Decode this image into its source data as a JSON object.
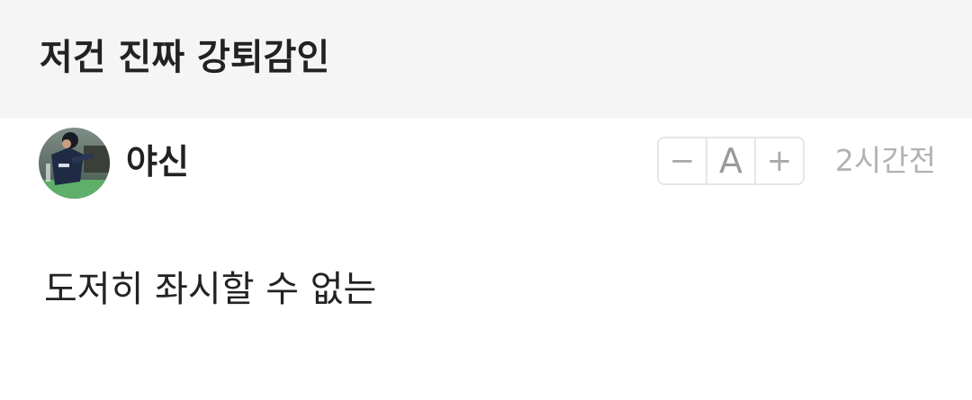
{
  "post": {
    "title": "저건 진짜 강퇴감인"
  },
  "author": {
    "name": "야신",
    "avatar": "baseball-player-photo"
  },
  "font_size_control": {
    "decrease_label": "−",
    "reset_label": "A",
    "increase_label": "+"
  },
  "meta": {
    "timestamp": "2시간전"
  },
  "content": {
    "text": "도저히 좌시할 수 없는"
  }
}
